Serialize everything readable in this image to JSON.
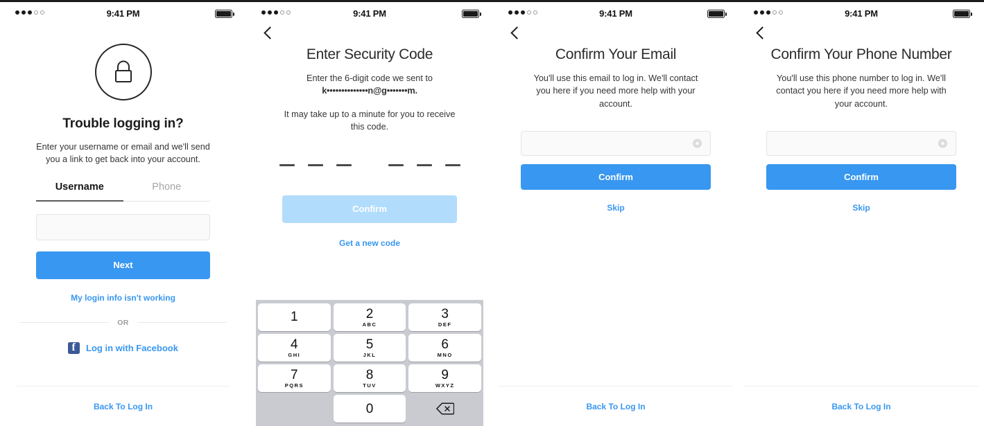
{
  "meta": {
    "accent_blue": "#3897f0",
    "accent_blue_disabled": "#b2dcfc",
    "facebook_blue": "#3b5998",
    "keypad_bg": "#c9cbd1",
    "text_dark": "#1c1c1c"
  },
  "status_bar": {
    "time": "9:41 PM",
    "signal_filled": 3,
    "signal_empty": 2,
    "battery": "full"
  },
  "screens": [
    {
      "id": "trouble-logging-in",
      "icon": "lock-icon",
      "title": "Trouble logging in?",
      "subtitle": "Enter your username or email and we'll send you a link to get back into your account.",
      "tabs": [
        {
          "label": "Username",
          "active": true
        },
        {
          "label": "Phone",
          "active": false
        }
      ],
      "input": {
        "value": "",
        "placeholder": ""
      },
      "primary_button": "Next",
      "help_link": "My login info isn't working",
      "divider_text": "OR",
      "facebook_label": "Log in with Facebook",
      "bottom_link": "Back To Log In"
    },
    {
      "id": "enter-security-code",
      "title": "Enter Security Code",
      "subtitle_prefix": "Enter the 6-digit code we sent to",
      "masked_recipient": "k••••••••••••••n@g•••••••m.",
      "subtitle_second": "It may take up to a minute for you to receive this code.",
      "code_slots": 6,
      "code_value": "",
      "primary_button": "Confirm",
      "primary_button_disabled": true,
      "secondary_link": "Get a new code",
      "keypad": [
        {
          "num": "1",
          "letters": ""
        },
        {
          "num": "2",
          "letters": "ABC"
        },
        {
          "num": "3",
          "letters": "DEF"
        },
        {
          "num": "4",
          "letters": "GHI"
        },
        {
          "num": "5",
          "letters": "JKL"
        },
        {
          "num": "6",
          "letters": "MNO"
        },
        {
          "num": "7",
          "letters": "PQRS"
        },
        {
          "num": "8",
          "letters": "TUV"
        },
        {
          "num": "9",
          "letters": "WXYZ"
        },
        {
          "num": "0",
          "letters": ""
        }
      ],
      "delete_key": "backspace-icon"
    },
    {
      "id": "confirm-email",
      "title": "Confirm Your Email",
      "subtitle": "You'll use this email to log in. We'll contact you here if you need more help with your account.",
      "input": {
        "value": "",
        "placeholder": ""
      },
      "clear_icon": "clear-circle-icon",
      "primary_button": "Confirm",
      "secondary_link": "Skip",
      "bottom_link": "Back To Log In"
    },
    {
      "id": "confirm-phone",
      "title": "Confirm Your Phone Number",
      "subtitle": "You'll use this phone number to log in. We'll contact you here if you need more help with your account.",
      "input": {
        "value": "",
        "placeholder": ""
      },
      "clear_icon": "clear-circle-icon",
      "primary_button": "Confirm",
      "secondary_link": "Skip",
      "bottom_link": "Back To Log In"
    }
  ]
}
